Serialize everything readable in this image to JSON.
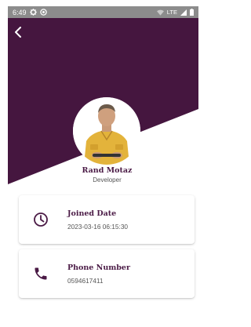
{
  "status_bar": {
    "time": "6:49",
    "left_icons": [
      "settings-icon",
      "blocked-icon"
    ],
    "network": "LTE",
    "right_icons": [
      "wifi-icon",
      "signal-icon",
      "battery-icon"
    ]
  },
  "colors": {
    "primary": "#45163F",
    "status_bar": "#8C8C8C",
    "background": "#FFFFFF",
    "icon": "#4A1A45"
  },
  "header": {
    "back_icon": "back-chevron-icon"
  },
  "profile": {
    "name": "Rand Motaz",
    "role": "Developer",
    "avatar_icon": "profile-photo"
  },
  "cards": [
    {
      "icon": "clock-icon",
      "title": "Joined Date",
      "value": "2023-03-16 06:15:30"
    },
    {
      "icon": "phone-icon",
      "title": "Phone Number",
      "value": "0594617411"
    }
  ]
}
